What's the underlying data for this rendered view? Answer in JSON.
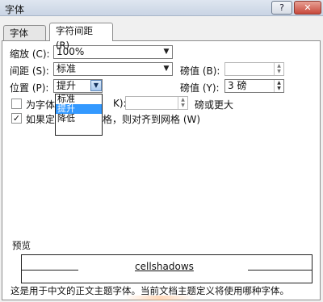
{
  "window": {
    "title": "字体",
    "help_label": "?",
    "close_label": "✕"
  },
  "tabs": [
    {
      "label": "字体 (N)",
      "active": false
    },
    {
      "label": "字符间距 (R)",
      "active": true
    }
  ],
  "form": {
    "scale": {
      "label": "缩放 (C):",
      "value": "100%"
    },
    "spacing": {
      "label": "间距 (S):",
      "value": "标准"
    },
    "spacing_by": {
      "label": "磅值 (B):",
      "value": ""
    },
    "position": {
      "label": "位置 (P):",
      "value": "提升"
    },
    "position_by": {
      "label": "磅值 (Y):",
      "value": "3 磅"
    },
    "kerning": {
      "label_prefix": "为字体",
      "label_suffix": "K):",
      "value": "",
      "suffix": "磅或更大",
      "checked": false
    },
    "grid": {
      "label_prefix": "如果定",
      "label_suffix": "格，则对齐到网格 (W)",
      "checked": true
    }
  },
  "position_dropdown": {
    "options": [
      "标准",
      "提升",
      "降低"
    ],
    "selected": "提升"
  },
  "preview": {
    "label": "预览",
    "sample": "cellshadows",
    "caption": "这是用于中文的正文主题字体。当前文档主题定义将使用哪种字体。"
  },
  "icons": {
    "dropdown": "chevron-down-icon",
    "spinner": "spinner-arrows-icon",
    "checkmark": "checkmark-icon"
  }
}
